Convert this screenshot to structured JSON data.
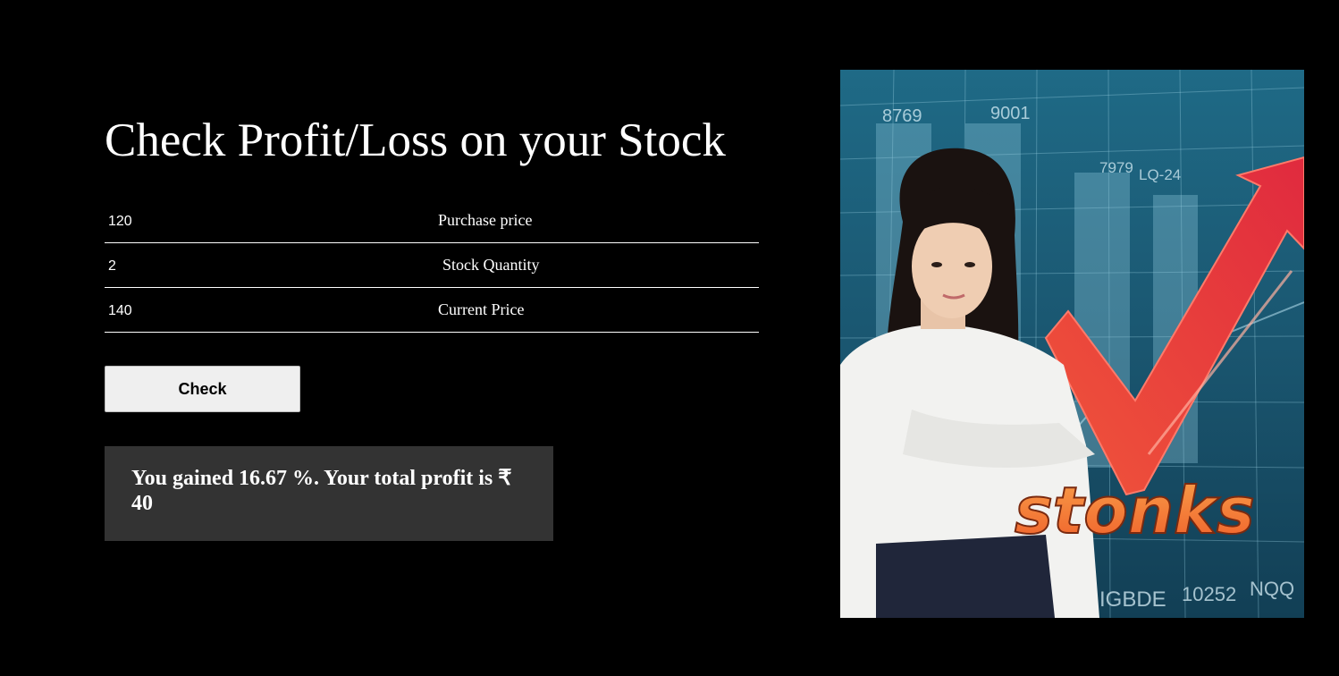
{
  "header": {
    "title": "Check Profit/Loss on your Stock"
  },
  "form": {
    "purchase_price": {
      "value": "120",
      "label": "Purchase price"
    },
    "stock_quantity": {
      "value": "2",
      "label": "Stock Quantity"
    },
    "current_price": {
      "value": "140",
      "label": "Current Price"
    },
    "check_label": "Check"
  },
  "output": {
    "message": "You gained 16.67 %. Your total profit is ₹ 40"
  },
  "illustration": {
    "caption": "stonks",
    "chart_labels": [
      "8769",
      "9001",
      "7979",
      "LQ-24",
      "IGBDE",
      "10252",
      "NQQ"
    ]
  },
  "colors": {
    "background": "#000000",
    "text": "#ffffff",
    "button_bg": "#efefef",
    "output_bg": "#333333",
    "arrow_red": "#e8323c",
    "stonks_orange": "#f47a3a"
  }
}
